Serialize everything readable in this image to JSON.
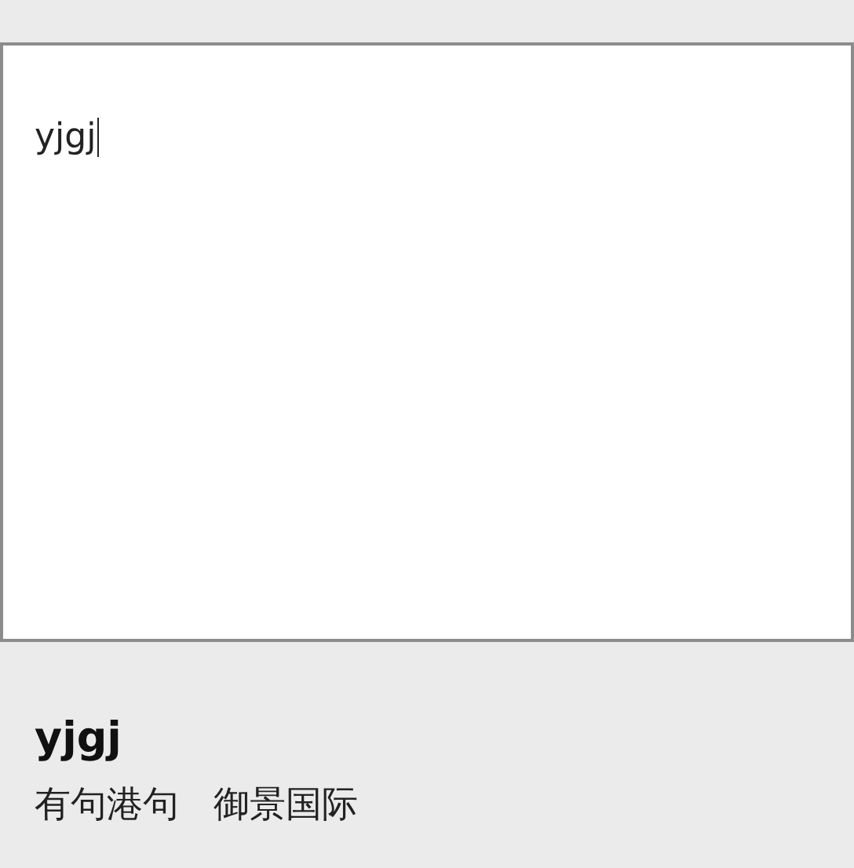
{
  "editor": {
    "value": "yjgj"
  },
  "ime": {
    "composition": "yjgj",
    "candidates": [
      {
        "text": "有句港句"
      },
      {
        "text": "御景国际"
      }
    ]
  }
}
